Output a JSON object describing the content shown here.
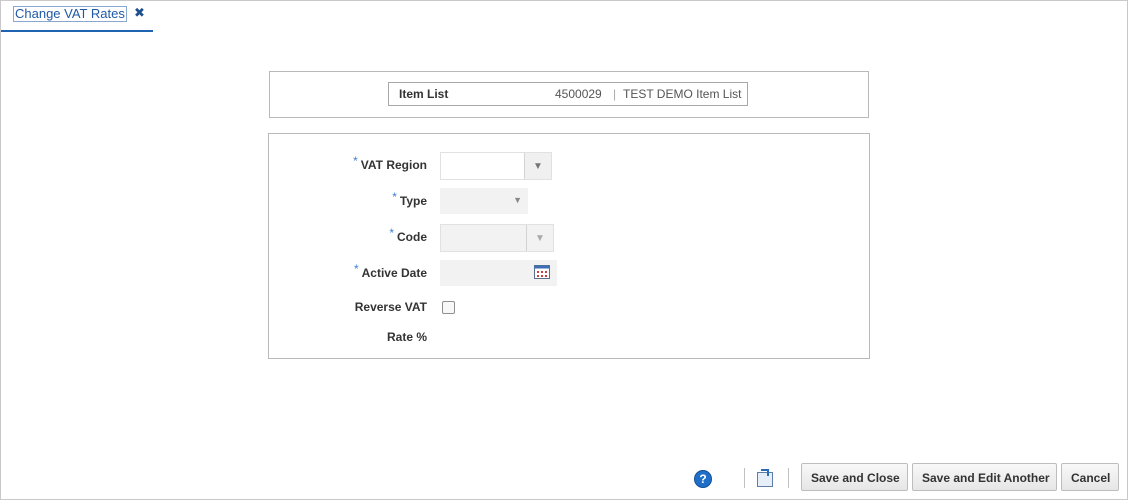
{
  "tab": {
    "label": "Change VAT Rates",
    "close": "✖"
  },
  "header": {
    "label": "Item List",
    "id": "4500029",
    "separator": "|",
    "description": "TEST DEMO Item List"
  },
  "form": {
    "required_mark": "*",
    "vat_region_label": "VAT Region",
    "type_label": "Type",
    "code_label": "Code",
    "active_date_label": "Active Date",
    "reverse_vat_label": "Reverse VAT",
    "rate_label": "Rate %"
  },
  "footer": {
    "help": "?",
    "save_close": "Save and Close",
    "save_edit": "Save and Edit Another",
    "cancel": "Cancel"
  },
  "icons": {
    "dropdown": "▼",
    "calendar": "calendar-icon",
    "help": "help-icon",
    "export": "export-icon"
  },
  "colors": {
    "accent": "#1f63b3",
    "required": "#3f7fd0"
  }
}
